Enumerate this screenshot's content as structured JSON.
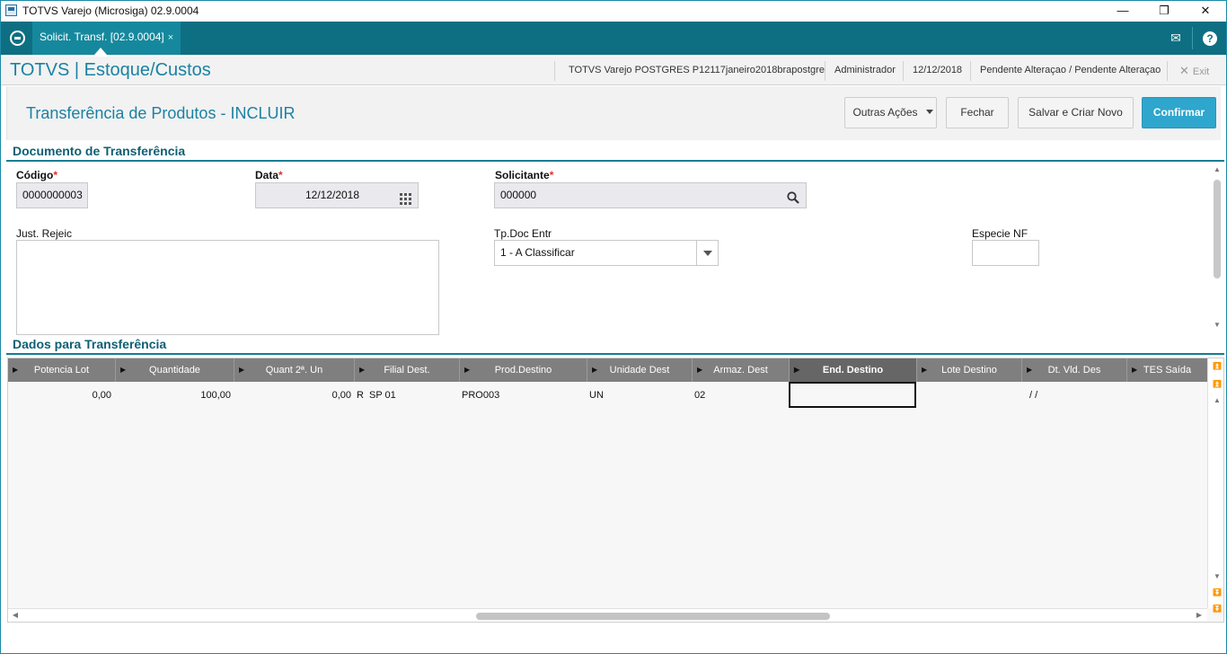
{
  "window": {
    "title": "TOTVS Varejo (Microsiga) 02.9.0004",
    "minimize": "—",
    "maximize": "❐",
    "close": "✕"
  },
  "tabbar": {
    "tab_label": "Solicit. Transf. [02.9.0004]",
    "tab_close": "×",
    "mail_icon": "✉",
    "help_icon": "?"
  },
  "header": {
    "app_title": "TOTVS | Estoque/Custos",
    "environment": "TOTVS Varejo POSTGRES P12117janeiro2018brapostgre",
    "user": "Administrador",
    "date": "12/12/2018",
    "status": "Pendente Alteraçao / Pendente Alteraçao",
    "exit_label": "Exit"
  },
  "actions": {
    "page_title": "Transferência de Produtos - INCLUIR",
    "other_actions": "Outras Ações",
    "close": "Fechar",
    "save_new": "Salvar e Criar Novo",
    "confirm": "Confirmar"
  },
  "doc_section": {
    "title": "Documento de Transferência",
    "codigo_label": "Código",
    "codigo_value": "0000000003",
    "data_label": "Data",
    "data_value": "12/12/2018",
    "solicitante_label": "Solicitante",
    "solicitante_value": "000000",
    "just_label": "Just. Rejeic",
    "just_value": "",
    "tpdoc_label": "Tp.Doc Entr",
    "tpdoc_value": "1 - A Classificar",
    "especie_label": "Especie NF",
    "especie_value": "",
    "required_mark": "*"
  },
  "transfer_section": {
    "title": "Dados para Transferência",
    "columns": [
      "Potencia Lot",
      "Quantidade",
      "Quant 2ª. Un",
      "Filial Dest.",
      "Prod.Destino",
      "Unidade Dest",
      "Armaz. Dest",
      "End. Destino",
      "Lote Destino",
      "Dt. Vld. Des",
      "TES Saída"
    ],
    "active_column": "End. Destino",
    "row": {
      "potencia_lot": "0,00",
      "quantidade": "100,00",
      "quant_2un": "0,00",
      "filial_prefix": "R",
      "filial_dest": "SP 01",
      "prod_destino": "PRO003",
      "unidade_dest": "UN",
      "armaz_dest": "02",
      "end_destino": "",
      "dt_vld_des": "/ /"
    }
  },
  "colors": {
    "brand": "#0e6f82",
    "accent": "#2ea6cd",
    "title_blue": "#1a82a3",
    "required": "#e0302a"
  },
  "icons": {
    "calendar": "calendar-icon",
    "search": "search-icon",
    "dropdown": "chevron-down-icon"
  }
}
